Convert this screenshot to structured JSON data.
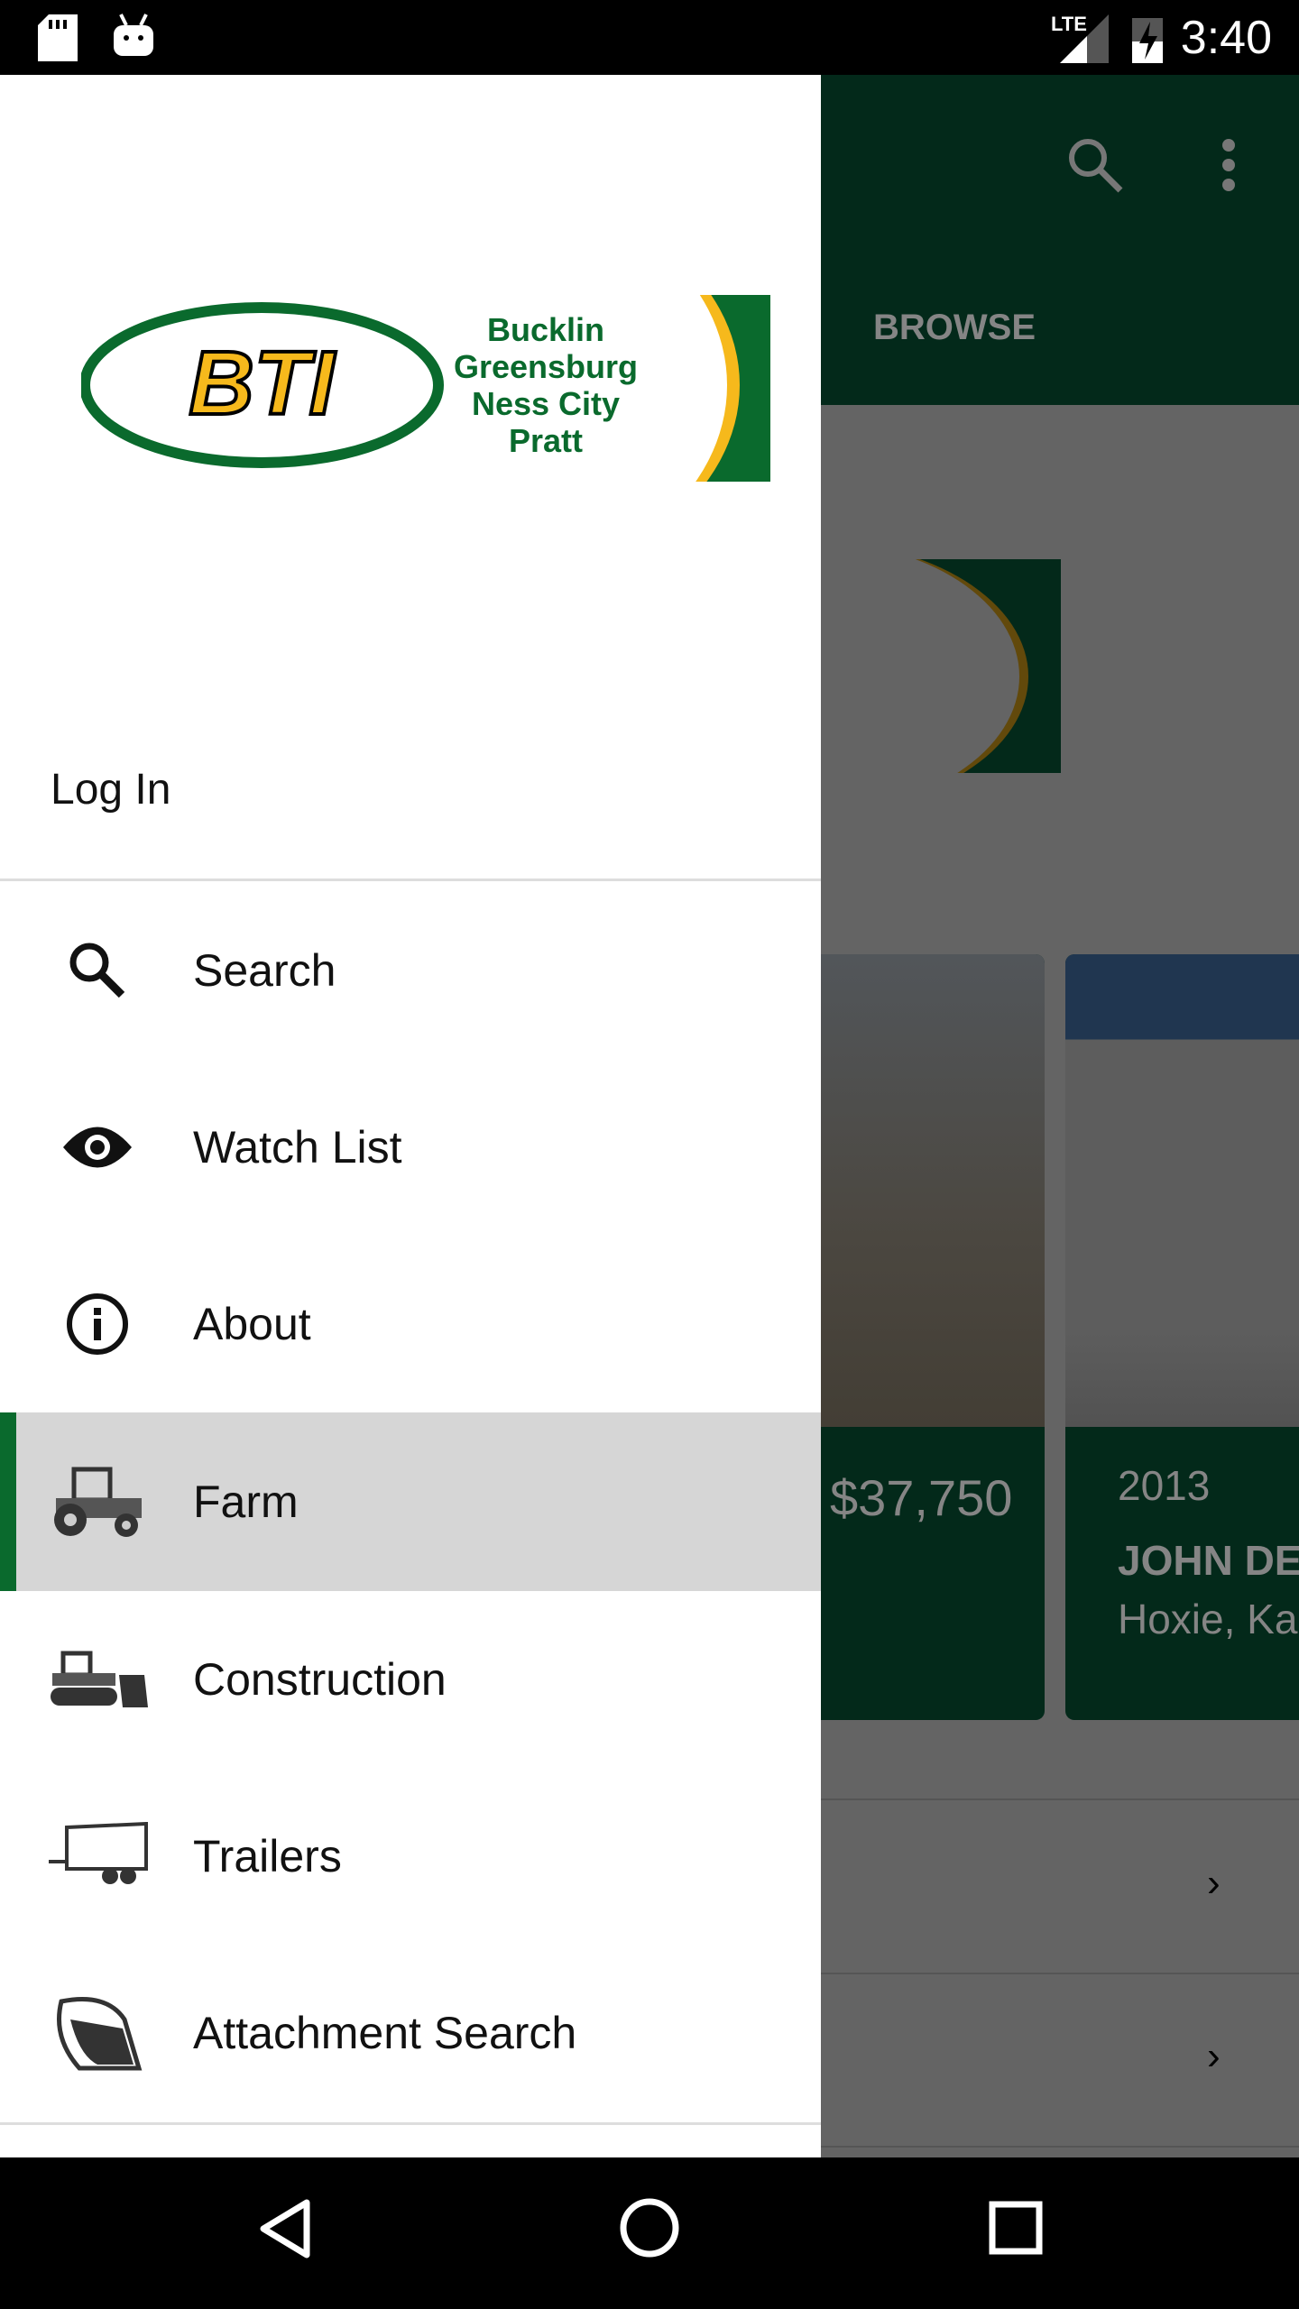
{
  "status_bar": {
    "time": "3:40",
    "network": "LTE",
    "icons": [
      "sd-card-icon",
      "android-icon",
      "signal-icon",
      "battery-charging-icon"
    ]
  },
  "app_bar": {
    "tab": "BROWSE",
    "icons": [
      "search-icon",
      "more-vert-icon"
    ]
  },
  "logo": {
    "brand": "BTI",
    "locations": [
      "Bucklin",
      "Greensburg",
      "Ness City",
      "Pratt"
    ]
  },
  "background": {
    "card1": {
      "price": "$37,750"
    },
    "card2": {
      "year": "2013",
      "title": "JOHN DE",
      "location": "Hoxie, Ka"
    }
  },
  "drawer": {
    "login": "Log In",
    "items": [
      {
        "label": "Search",
        "icon": "search-icon"
      },
      {
        "label": "Watch List",
        "icon": "eye-icon"
      },
      {
        "label": "About",
        "icon": "info-icon"
      },
      {
        "label": "Farm",
        "icon": "tractor-icon",
        "selected": true
      },
      {
        "label": "Construction",
        "icon": "bulldozer-icon"
      },
      {
        "label": "Trailers",
        "icon": "trailer-icon"
      },
      {
        "label": "Attachment Search",
        "icon": "bucket-icon"
      }
    ]
  },
  "colors": {
    "brand_green": "#0a6a2d",
    "brand_yellow": "#f6b91c",
    "selected_bg": "#d6d6d6"
  }
}
